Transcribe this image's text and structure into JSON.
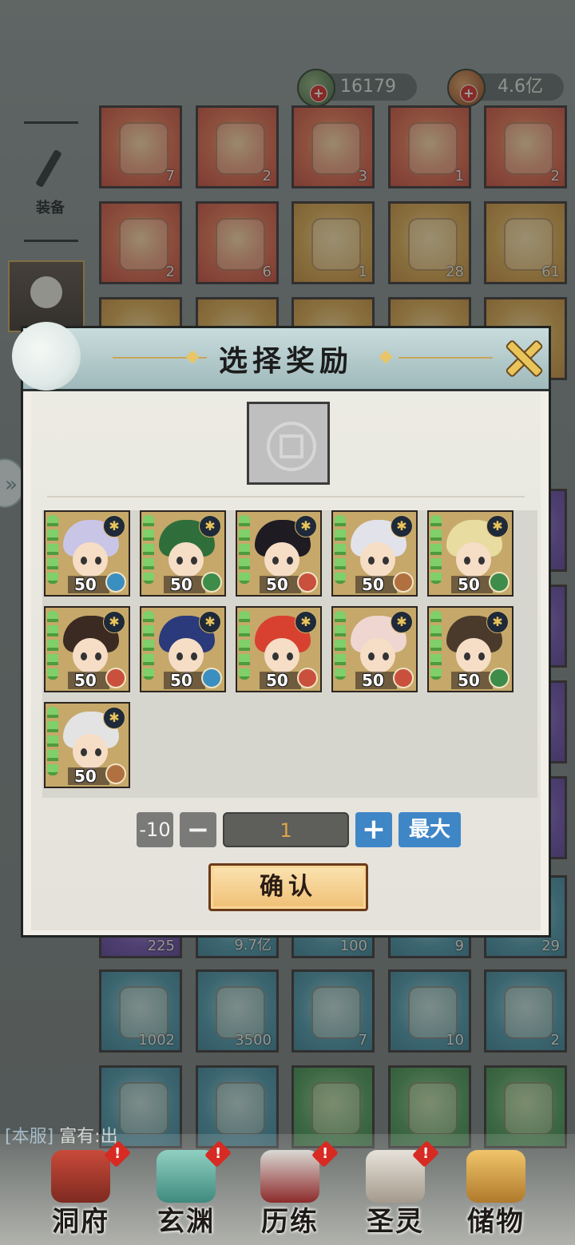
{
  "currencies": [
    {
      "icon": "jade-coin-icon",
      "value": "16179"
    },
    {
      "icon": "spirit-stone-icon",
      "value": "4.6亿"
    }
  ],
  "sidebar": {
    "equip_label": "装备"
  },
  "inventory": {
    "row1": [
      {
        "count": "7"
      },
      {
        "count": "2"
      },
      {
        "count": "3"
      },
      {
        "count": "1"
      },
      {
        "count": "2"
      }
    ],
    "row2": [
      {
        "count": "2"
      },
      {
        "count": "6"
      },
      {
        "count": "1"
      },
      {
        "count": "28"
      },
      {
        "count": "61"
      }
    ],
    "row_mid": [
      {
        "count": "225"
      },
      {
        "count": "9.7亿"
      },
      {
        "count": "100"
      },
      {
        "count": "9"
      },
      {
        "count": "29"
      }
    ],
    "row4": [
      {
        "count": "1002"
      },
      {
        "count": "3500"
      },
      {
        "count": "7"
      },
      {
        "count": "10"
      },
      {
        "count": "2"
      }
    ]
  },
  "modal": {
    "title": "选择奖励",
    "heroes": [
      {
        "level": "50",
        "element": "water",
        "hair": "#c9c5e6"
      },
      {
        "level": "50",
        "element": "wood",
        "hair": "#2f6e3a"
      },
      {
        "level": "50",
        "element": "fire",
        "hair": "#1e1b22"
      },
      {
        "level": "50",
        "element": "earth",
        "hair": "#e2e2ea"
      },
      {
        "level": "50",
        "element": "wood",
        "hair": "#e8dca0"
      },
      {
        "level": "50",
        "element": "fire",
        "hair": "#3a2a22"
      },
      {
        "level": "50",
        "element": "water",
        "hair": "#2a3a7a"
      },
      {
        "level": "50",
        "element": "fire",
        "hair": "#d8412f"
      },
      {
        "level": "50",
        "element": "fire",
        "hair": "#efd6d0"
      },
      {
        "level": "50",
        "element": "wood",
        "hair": "#4a3a2c"
      },
      {
        "level": "50",
        "element": "earth",
        "hair": "#e3e3e3"
      }
    ],
    "qty": {
      "minus10_label": "-10",
      "minus_label": "−",
      "value": "1",
      "plus_label": "+",
      "max_label": "最大"
    },
    "confirm_label": "确认"
  },
  "chat": {
    "channel": "[本服]",
    "text": "富有:出"
  },
  "bottom_nav": [
    {
      "label": "洞府",
      "badge": "!"
    },
    {
      "label": "玄渊",
      "badge": "!"
    },
    {
      "label": "历练",
      "badge": "!"
    },
    {
      "label": "圣灵",
      "badge": "!"
    },
    {
      "label": "储物",
      "badge": ""
    }
  ]
}
